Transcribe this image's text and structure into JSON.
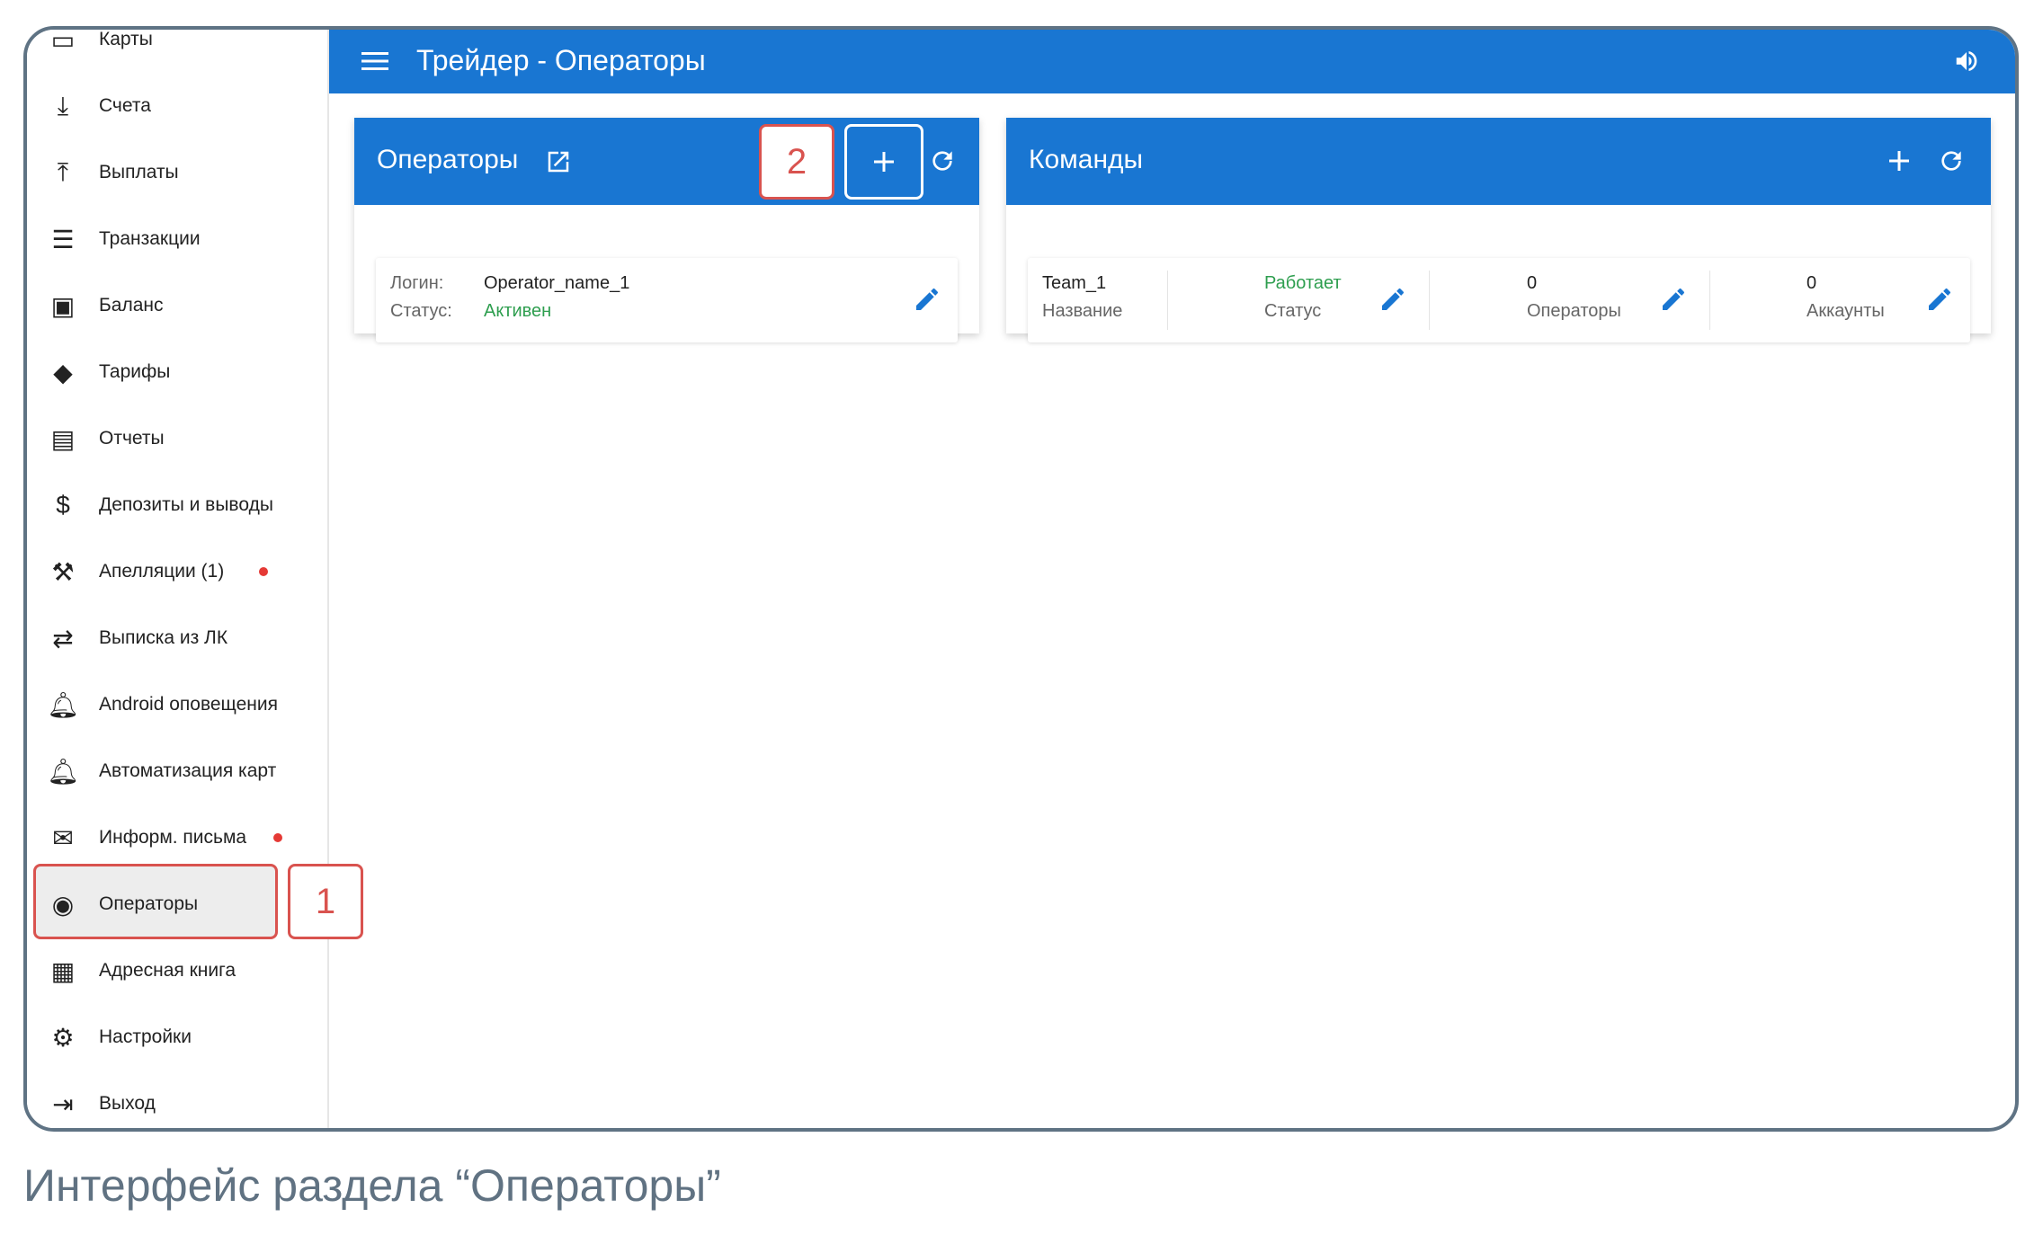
{
  "sidebar": {
    "items": [
      {
        "label": "Карты",
        "icon": "credit-card-icon"
      },
      {
        "label": "Счета",
        "icon": "download-icon"
      },
      {
        "label": "Выплаты",
        "icon": "upload-icon"
      },
      {
        "label": "Транзакции",
        "icon": "list-icon"
      },
      {
        "label": "Баланс",
        "icon": "wallet-icon"
      },
      {
        "label": "Тарифы",
        "icon": "tag-icon"
      },
      {
        "label": "Отчеты",
        "icon": "receipt-icon"
      },
      {
        "label": "Депозиты и выводы",
        "icon": "currency-exchange-icon"
      },
      {
        "label": "Апелляции (1)",
        "icon": "gavel-icon",
        "dot": true
      },
      {
        "label": "Выписка из ЛК",
        "icon": "swap-icon"
      },
      {
        "label": "Android оповещения",
        "icon": "bell-icon"
      },
      {
        "label": "Автоматизация карт",
        "icon": "bell-icon"
      },
      {
        "label": "Информ. письма",
        "icon": "mail-icon",
        "dot": true
      },
      {
        "label": "Операторы",
        "icon": "operators-icon",
        "selected": true
      },
      {
        "label": "Адресная книга",
        "icon": "contacts-icon"
      },
      {
        "label": "Настройки",
        "icon": "gear-icon"
      },
      {
        "label": "Выход",
        "icon": "logout-icon"
      }
    ]
  },
  "header": {
    "title": "Трейдер - Операторы"
  },
  "markers": {
    "one": "1",
    "two": "2"
  },
  "operators": {
    "title": "Операторы",
    "login_label": "Логин:",
    "login": "Operator_name_1",
    "status_label": "Статус:",
    "status": "Активен"
  },
  "teams": {
    "title": "Команды",
    "name": "Team_1",
    "name_label": "Название",
    "status": "Работает",
    "status_label": "Статус",
    "operators": "0",
    "operators_label": "Операторы",
    "accounts": "0",
    "accounts_label": "Аккаунты"
  },
  "caption": "Интерфейс раздела “Операторы”",
  "colors": {
    "primary": "#1976d2",
    "active": "#2e9e4f",
    "marker": "#d9534f"
  }
}
